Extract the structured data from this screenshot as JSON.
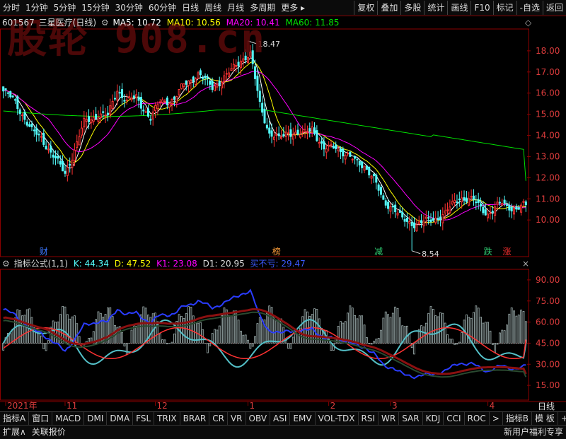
{
  "toolbar": {
    "left": [
      "分时",
      "1分钟",
      "5分钟",
      "15分钟",
      "30分钟",
      "60分钟",
      "日线",
      "周线",
      "月线",
      "多周期",
      "更多 ▸"
    ],
    "right": [
      "复权",
      "叠加",
      "多股",
      "统计",
      "画线",
      "F10",
      "标记",
      "-自选",
      "返回"
    ]
  },
  "watermark": "股轮 908.cn",
  "header": {
    "code": "601567",
    "name": "三星医疗(日线)",
    "ma5_label": "MA5: 10.72",
    "ma10_label": "MA10: 10.56",
    "ma20_label": "MA20: 10.41",
    "ma60_label": "MA60: 11.85"
  },
  "indicator_header": {
    "name": "指标公式(1,1)",
    "k": "K: 44.34",
    "d": "D: 47.52",
    "k1": "K1: 23.08",
    "d1": "D1: 20.95",
    "buy": "买不亏: 29.47"
  },
  "price_axis": {
    "ticks": [
      18.0,
      17.0,
      16.0,
      15.0,
      14.0,
      13.0,
      12.0,
      11.0,
      10.0
    ],
    "range": [
      8.3,
      19.0
    ]
  },
  "ind_axis": {
    "ticks": [
      90.0,
      75.0,
      60.0,
      45.0,
      30.0,
      15.0
    ],
    "range": [
      5,
      97
    ]
  },
  "annotations": {
    "high": "18.47",
    "low": "8.54"
  },
  "event_labels": [
    {
      "text": "财",
      "color": "#3c78ff",
      "index": 17
    },
    {
      "text": "榜",
      "color": "#ff9f3a",
      "index": 115
    },
    {
      "text": "减",
      "color": "#2ecc71",
      "index": 158
    },
    {
      "text": "跌",
      "color": "#2ecc71",
      "index": 204
    },
    {
      "text": "涨",
      "color": "#ff3030",
      "index": 212
    }
  ],
  "date_axis": [
    {
      "text": "2021年",
      "index": 1
    },
    {
      "text": "11",
      "index": 26
    },
    {
      "text": "12",
      "index": 64
    },
    {
      "text": "1",
      "index": 103
    },
    {
      "text": "2",
      "index": 137
    },
    {
      "text": "3",
      "index": 163
    },
    {
      "text": "4",
      "index": 204
    }
  ],
  "period_label": "日线",
  "bottom_tabs": [
    "指标A",
    "窗口",
    "MACD",
    "DMI",
    "DMA",
    "FSL",
    "TRIX",
    "BRAR",
    "CR",
    "VR",
    "OBV",
    "ASI",
    "EMV",
    "VOL-TDX",
    "RSI",
    "WR",
    "SAR",
    "KDJ",
    "CCI",
    "ROC",
    ">"
  ],
  "bottom_right": [
    "指标B",
    "模 板",
    "+",
    "-"
  ],
  "status": {
    "left": [
      "扩展∧",
      "关联报价"
    ],
    "right": "新用户福利专享"
  },
  "colors": {
    "up": "#ff3232",
    "down": "#54ffff",
    "ma5": "#ffffff",
    "ma10": "#ffff00",
    "ma20": "#ff00ff",
    "ma60": "#00e000",
    "border": "#8b0000"
  },
  "chart_data": [
    {
      "type": "candlestick",
      "title": "601567 三星医疗(日线)",
      "x_range_label": [
        "2021年",
        "11",
        "12",
        "1",
        "2",
        "3",
        "4"
      ],
      "ylim": [
        8.3,
        19.0
      ],
      "series": [
        {
          "name": "MA5",
          "last": 10.72
        },
        {
          "name": "MA10",
          "last": 10.56
        },
        {
          "name": "MA20",
          "last": 10.41
        },
        {
          "name": "MA60",
          "last": 11.85
        }
      ],
      "anchors": [
        {
          "i": 0,
          "v": 16.1
        },
        {
          "i": 5,
          "v": 15.6
        },
        {
          "i": 12,
          "v": 14.2
        },
        {
          "i": 16,
          "v": 13.9
        },
        {
          "i": 20,
          "v": 13.2
        },
        {
          "i": 26,
          "v": 12.2
        },
        {
          "i": 30,
          "v": 13.3
        },
        {
          "i": 34,
          "v": 14.6
        },
        {
          "i": 40,
          "v": 15.0
        },
        {
          "i": 44,
          "v": 14.9
        },
        {
          "i": 48,
          "v": 16.2
        },
        {
          "i": 52,
          "v": 15.6
        },
        {
          "i": 56,
          "v": 15.8
        },
        {
          "i": 62,
          "v": 14.8
        },
        {
          "i": 66,
          "v": 15.6
        },
        {
          "i": 72,
          "v": 15.7
        },
        {
          "i": 76,
          "v": 16.4
        },
        {
          "i": 82,
          "v": 16.9
        },
        {
          "i": 88,
          "v": 16.3
        },
        {
          "i": 94,
          "v": 16.8
        },
        {
          "i": 100,
          "v": 17.6
        },
        {
          "i": 104,
          "v": 17.8
        },
        {
          "i": 108,
          "v": 15.5
        },
        {
          "i": 112,
          "v": 14.1
        },
        {
          "i": 116,
          "v": 13.8
        },
        {
          "i": 120,
          "v": 14.2
        },
        {
          "i": 126,
          "v": 14.0
        },
        {
          "i": 130,
          "v": 14.4
        },
        {
          "i": 135,
          "v": 13.3
        },
        {
          "i": 140,
          "v": 13.5
        },
        {
          "i": 146,
          "v": 12.9
        },
        {
          "i": 152,
          "v": 12.6
        },
        {
          "i": 156,
          "v": 11.9
        },
        {
          "i": 160,
          "v": 10.9
        },
        {
          "i": 164,
          "v": 10.6
        },
        {
          "i": 168,
          "v": 10.0
        },
        {
          "i": 174,
          "v": 9.8
        },
        {
          "i": 180,
          "v": 10.0
        },
        {
          "i": 186,
          "v": 10.3
        },
        {
          "i": 192,
          "v": 11.1
        },
        {
          "i": 198,
          "v": 10.9
        },
        {
          "i": 204,
          "v": 10.3
        },
        {
          "i": 210,
          "v": 10.8
        },
        {
          "i": 216,
          "v": 10.5
        },
        {
          "i": 220,
          "v": 10.72
        }
      ],
      "high": 18.47,
      "low": 8.54
    },
    {
      "type": "line",
      "title": "指标公式(1,1)",
      "ylim": [
        5,
        97
      ],
      "series": [
        {
          "name": "K",
          "last": 44.34
        },
        {
          "name": "D",
          "last": 47.52
        },
        {
          "name": "K1",
          "last": 23.08
        },
        {
          "name": "D1",
          "last": 20.95
        },
        {
          "name": "买不亏",
          "last": 29.47
        }
      ]
    }
  ]
}
